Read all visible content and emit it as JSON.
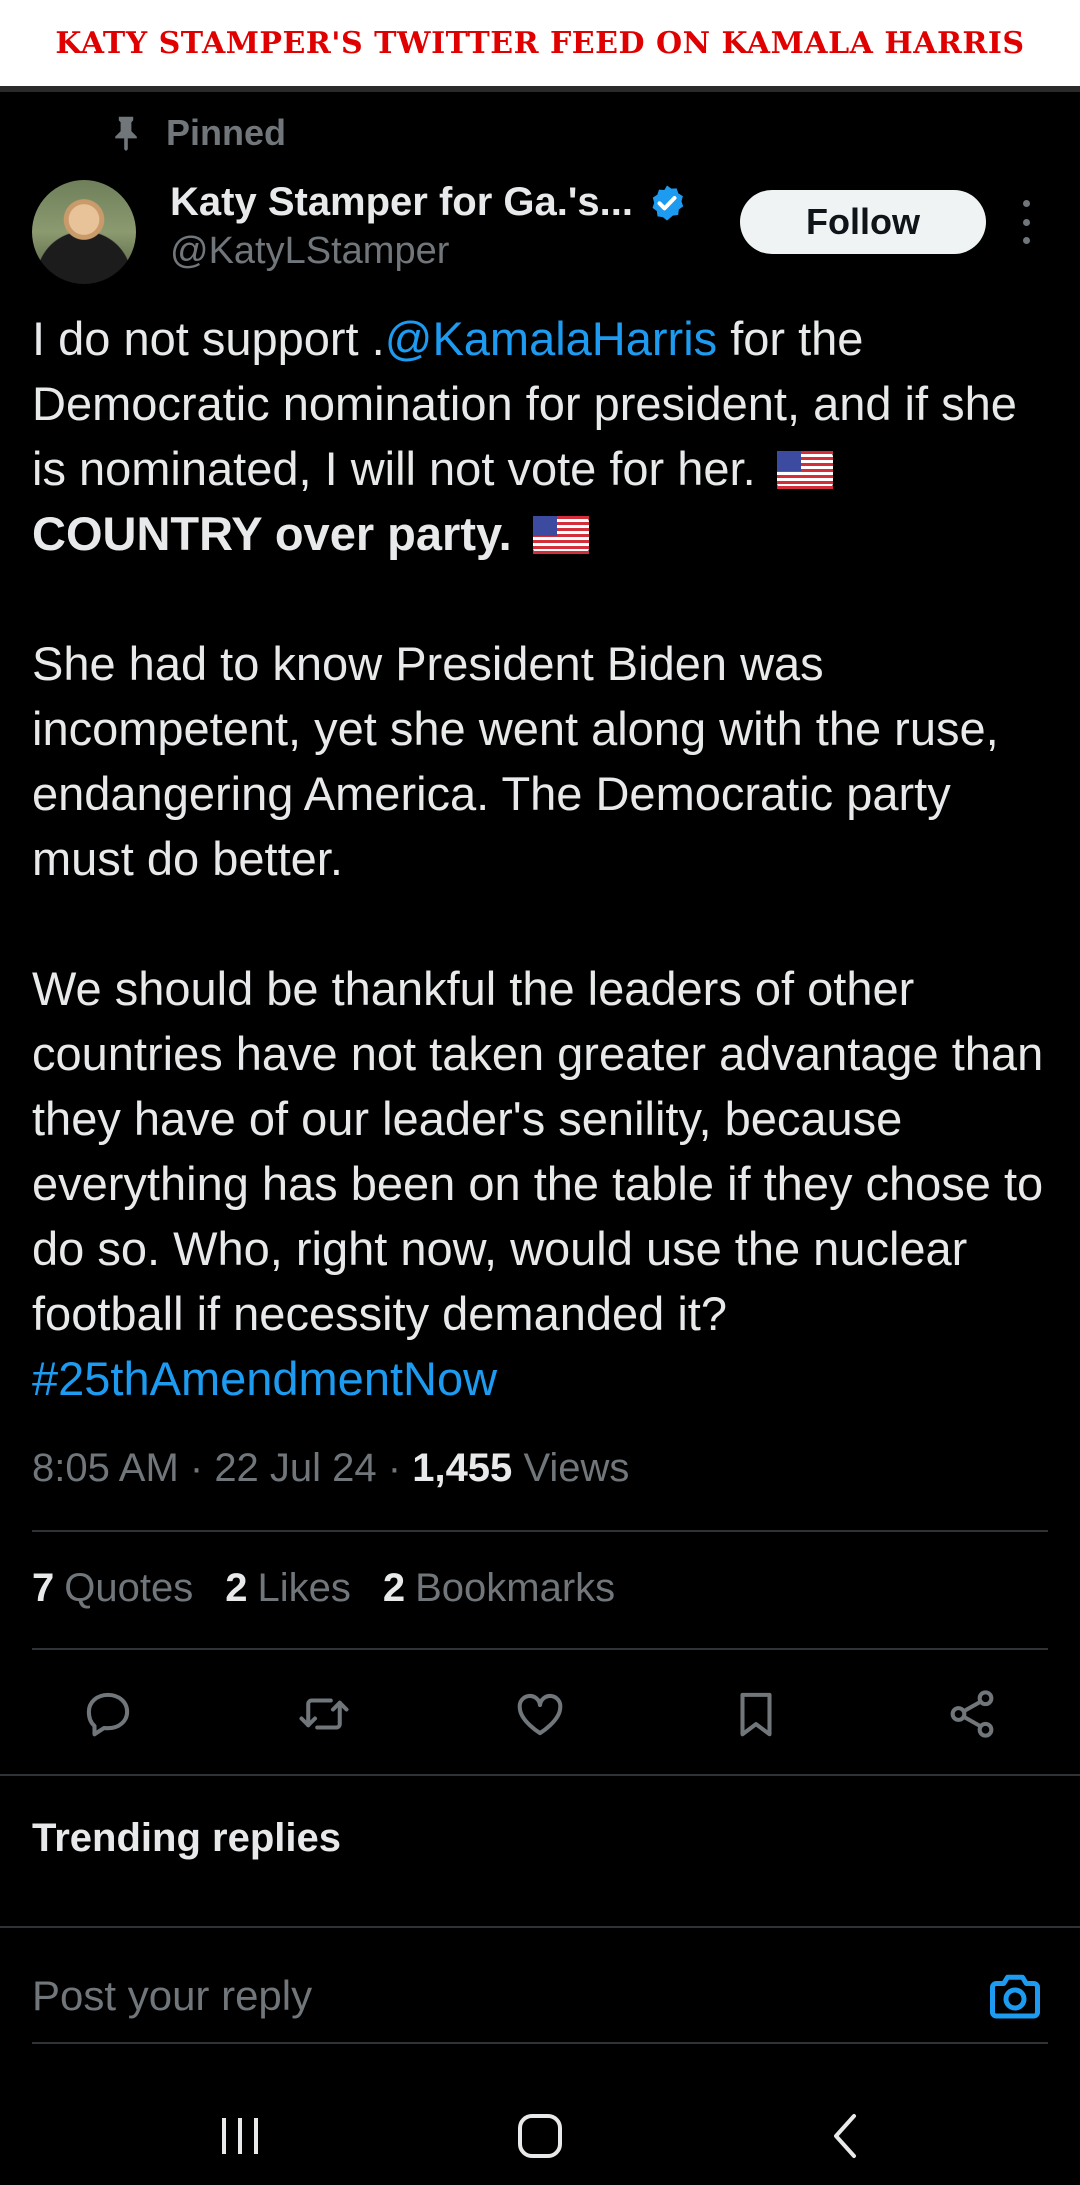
{
  "banner": {
    "title": "KATY STAMPER'S TWITTER FEED ON KAMALA HARRIS"
  },
  "pinned_label": "Pinned",
  "author": {
    "name": "Katy Stamper for Ga.'s...",
    "handle": "@KatyLStamper",
    "follow_label": "Follow"
  },
  "tweet": {
    "p1_a": "I do not support .",
    "p1_mention": "@KamalaHarris",
    "p1_b": " for the Democratic nomination for president, and if she is nominated, I will not vote for her.",
    "p1_bold": "COUNTRY over party.",
    "p2": "She had to know President Biden was incompetent, yet she went along with the ruse, endangering America.  The Democratic party must do better.",
    "p3": "We should be thankful the leaders of other countries have not taken greater advantage than they have of our leader's senility, because everything has been on the table if they chose to do so.    Who, right now, would use the nuclear football if necessity demanded it?",
    "p3_hashtag": "#25thAmendmentNow"
  },
  "meta": {
    "time": "8:05 AM",
    "date": "22 Jul 24",
    "views_count": "1,455",
    "views_label": "Views",
    "sep": " · "
  },
  "stats": {
    "quotes_count": "7",
    "quotes_label": "Quotes",
    "likes_count": "2",
    "likes_label": "Likes",
    "bookmarks_count": "2",
    "bookmarks_label": "Bookmarks"
  },
  "icons": [
    "reply-icon",
    "retweet-icon",
    "like-icon",
    "bookmark-icon",
    "share-icon",
    "camera-icon",
    "verified-badge-icon",
    "pin-icon"
  ],
  "trending_label": "Trending replies",
  "reply_placeholder": "Post your reply",
  "colors": {
    "accent": "#1d9bf0",
    "banner_text": "#e00000",
    "muted": "#71767b",
    "background": "#000000"
  }
}
